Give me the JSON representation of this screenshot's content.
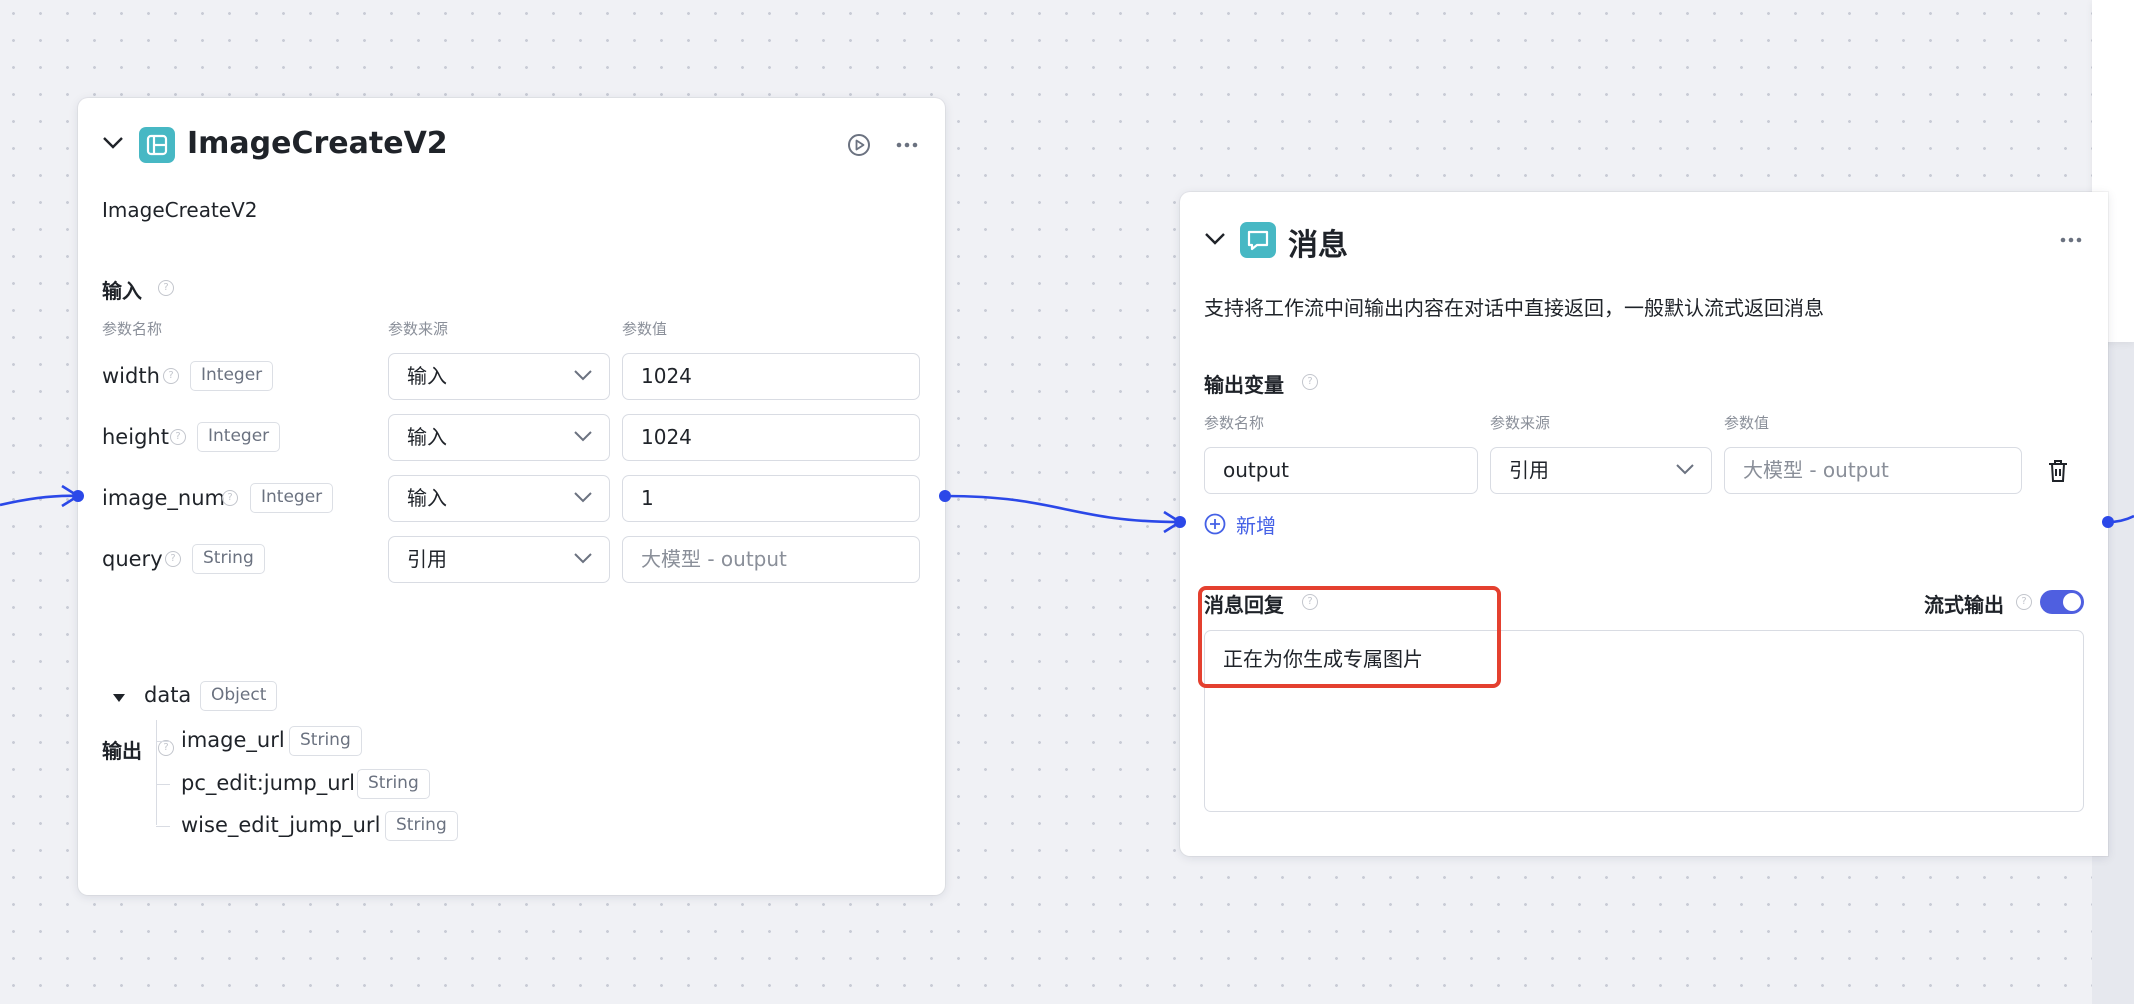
{
  "node_imagecreate": {
    "title": "ImageCreateV2",
    "description": "ImageCreateV2",
    "input_section": "输入",
    "col_name": "参数名称",
    "col_source": "参数来源",
    "col_value": "参数值",
    "inputs": [
      {
        "name": "width",
        "type": "Integer",
        "source": "输入",
        "value": "1024"
      },
      {
        "name": "height",
        "type": "Integer",
        "source": "输入",
        "value": "1024"
      },
      {
        "name": "image_num",
        "type": "Integer",
        "source": "输入",
        "value": "1"
      },
      {
        "name": "query",
        "type": "String",
        "source": "引用",
        "value": "大模型 - output"
      }
    ],
    "output_section": "输出",
    "output_root": {
      "name": "data",
      "type": "Object"
    },
    "output_children": [
      {
        "name": "image_url",
        "type": "String"
      },
      {
        "name": "pc_edit:jump_url",
        "type": "String"
      },
      {
        "name": "wise_edit_jump_url",
        "type": "String"
      }
    ]
  },
  "node_message": {
    "title": "消息",
    "description": "支持将工作流中间输出内容在对话中直接返回，一般默认流式返回消息",
    "output_vars_section": "输出变量",
    "col_name": "参数名称",
    "col_source": "参数来源",
    "col_value": "参数值",
    "var": {
      "name": "output",
      "source": "引用",
      "value": "大模型 - output"
    },
    "add_label": "新增",
    "reply_section": "消息回复",
    "stream_label": "流式输出",
    "stream_on": true,
    "reply_text": "正在为你生成专属图片"
  },
  "colors": {
    "accent": "#4460e6",
    "wire": "#2b48e8",
    "icon_tile": "#47b8c4",
    "highlight": "#e4402f",
    "toggle": "#4f5fe0"
  }
}
